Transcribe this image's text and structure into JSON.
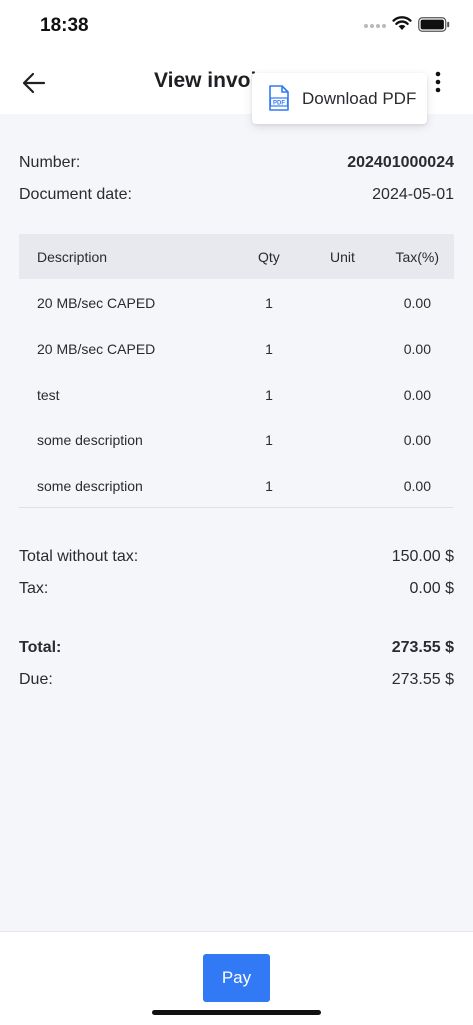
{
  "status_bar": {
    "time": "18:38"
  },
  "app_bar": {
    "title": "View invoice"
  },
  "menu": {
    "download_pdf": "Download PDF",
    "pdf_badge": "PDF"
  },
  "invoice": {
    "number_label": "Number:",
    "number_value": "202401000024",
    "date_label": "Document date:",
    "date_value": "2024-05-01"
  },
  "table": {
    "headers": {
      "description": "Description",
      "qty": "Qty",
      "unit": "Unit",
      "tax": "Tax(%)"
    },
    "rows": [
      {
        "description": "20 MB/sec CAPED",
        "qty": "1",
        "unit": "",
        "tax": "0.00"
      },
      {
        "description": "20 MB/sec CAPED",
        "qty": "1",
        "unit": "",
        "tax": "0.00"
      },
      {
        "description": "test",
        "qty": "1",
        "unit": "",
        "tax": "0.00"
      },
      {
        "description": "some description",
        "qty": "1",
        "unit": "",
        "tax": "0.00"
      },
      {
        "description": "some description",
        "qty": "1",
        "unit": "",
        "tax": "0.00"
      }
    ]
  },
  "totals": {
    "without_tax_label": "Total without tax:",
    "without_tax_value": "150.00 $",
    "tax_label": "Tax:",
    "tax_value": "0.00 $",
    "total_label": "Total:",
    "total_value": "273.55 $",
    "due_label": "Due:",
    "due_value": "273.55 $"
  },
  "footer": {
    "pay_label": "Pay"
  },
  "colors": {
    "accent": "#3279f6",
    "background": "#f5f6fa",
    "header_row": "#e7e9ee"
  }
}
